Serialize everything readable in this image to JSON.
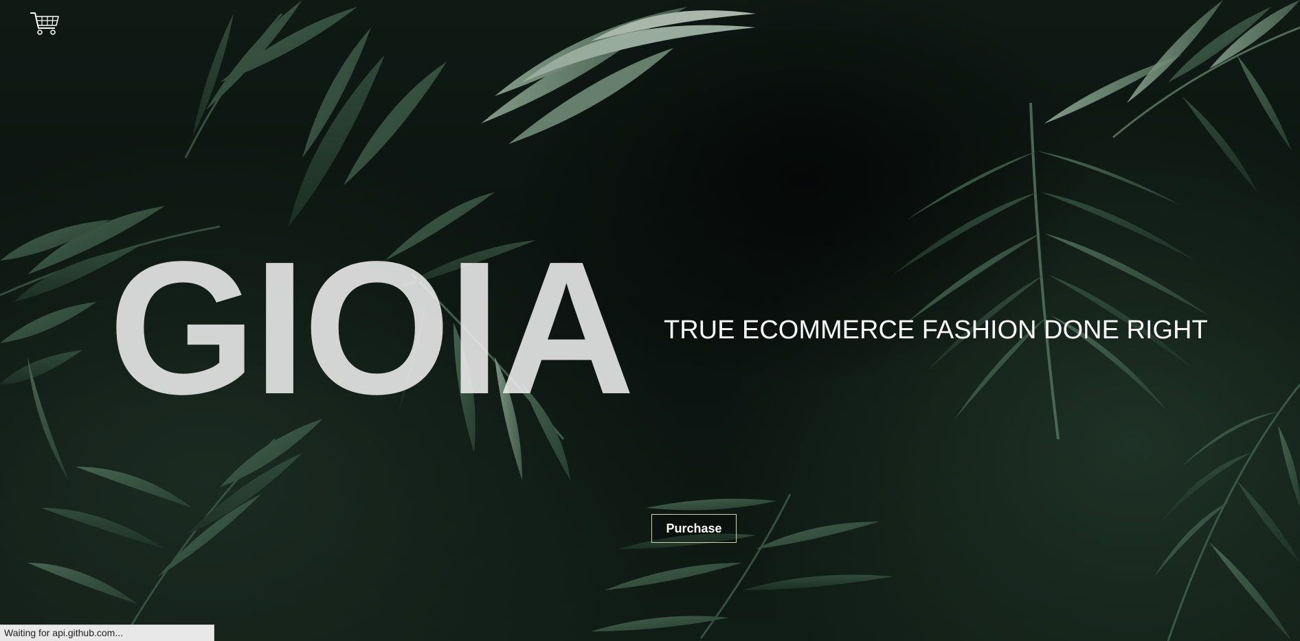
{
  "header": {
    "cart_icon": "shopping-cart-icon"
  },
  "hero": {
    "brand": "GIOIA",
    "tagline": "TRUE ECOMMERCE FASHION DONE RIGHT",
    "purchase_label": "Purchase",
    "background": "tropical-palm-leaves-photo"
  },
  "status_bar": {
    "text": "Waiting for api.github.com..."
  },
  "colors": {
    "brand_text": "#eeeeee",
    "button_border": "#d8d2a8",
    "leaf_green": "#3b5a45"
  }
}
